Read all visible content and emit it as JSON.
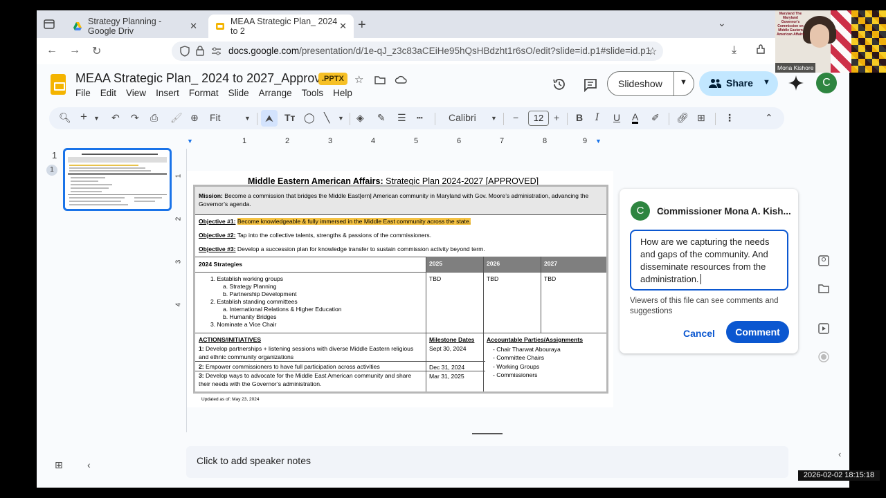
{
  "browser": {
    "tabs": [
      {
        "label": "Strategy Planning - Google Driv",
        "active": false
      },
      {
        "label": "MEAA Strategic Plan_ 2024 to 2",
        "active": true
      }
    ],
    "url_prefix": "docs.google.com",
    "url_rest": "/presentation/d/1e-qJ_z3c83aCEiHe95hQsHBdzht1r6sO/edit?slide=id.p1#slide=id.p1"
  },
  "doc": {
    "title": "MEAA Strategic Plan_ 2024 to 2027_Approved",
    "badge": ".PPTX",
    "menus": [
      "File",
      "Edit",
      "View",
      "Insert",
      "Format",
      "Slide",
      "Arrange",
      "Tools",
      "Help"
    ],
    "slideshow_label": "Slideshow",
    "share_label": "Share",
    "avatar_letter": "C"
  },
  "toolbar": {
    "zoom": "Fit",
    "font": "Calibri",
    "font_size": "12"
  },
  "filmstrip": {
    "slide_number": "1",
    "badge": "1"
  },
  "ruler": [
    "1",
    "2",
    "3",
    "4",
    "5",
    "6",
    "7",
    "8",
    "9"
  ],
  "vruler": [
    "1",
    "2",
    "3",
    "4"
  ],
  "slide": {
    "title_bold": "Middle Eastern American Affairs:",
    "title_rest": " Strategic Plan 2024-2027 [APPROVED]",
    "mission_label": "Mission:",
    "mission_text": " Become a commission that bridges the Middle East[ern] American community in Maryland with Gov. Moore’s administration, advancing the Governor’s agenda.",
    "objectives": [
      {
        "label": "Objective #1:",
        "text": "Become knowledgeable & fully immersed in the Middle East community across the state."
      },
      {
        "label": "Objective #2:",
        "text": "Tap into the collective talents, strengths & passions of the commissioners."
      },
      {
        "label": "Objective #3:",
        "text": "Develop a succession plan for knowledge transfer to sustain commission activity beyond term."
      }
    ],
    "strategies_header": "2024 Strategies",
    "year_headers": [
      "2025",
      "2026",
      "2027"
    ],
    "strategies": [
      "1.     Establish working groups",
      "a.     Strategy Planning",
      "b.     Partnership Development",
      "2.     Establish standing committees",
      "a.     International Relations & Higher Education",
      "b.     Humanity Bridges",
      "3.     Nominate a Vice Chair"
    ],
    "tbd": [
      "TBD",
      "TBD",
      "TBD"
    ],
    "actions_header": "ACTIONS/INITIATIVES",
    "milestone_header_1": "Milestone",
    "milestone_header_2": "Dates",
    "accountable_header": "Accountable Parties/Assignments",
    "actions": [
      {
        "num": "1:",
        "text": "Develop partnerships + listening sessions with diverse Middle Eastern religious and ethnic community organizations",
        "date": "Sept 30, 2024"
      },
      {
        "num": "2:",
        "text": "Empower commissioners to have full participation across activities",
        "date": "Dec 31, 2024"
      },
      {
        "num": "3:",
        "text": "Develop ways to advocate for the Middle East American community and share their needs with the Governor’s administration.",
        "date": "Mar 31, 2025"
      }
    ],
    "accountable": [
      "-     Chair Tharwat Abouraya",
      "-     Committee Chairs",
      "-     Working Groups",
      "-     Commissioners"
    ],
    "updated": "Updated as of: May 23, 2024"
  },
  "comment": {
    "avatar_letter": "C",
    "author": "Commissioner Mona A. Kish...",
    "text": "How are we capturing the needs and gaps of the community. And disseminate resources from the administration.",
    "note": "Viewers of this file can see comments and suggestions",
    "cancel_label": "Cancel",
    "submit_label": "Comment"
  },
  "notes": {
    "placeholder": "Click to add speaker notes"
  },
  "webcam": {
    "name": "Mona Kishore",
    "seal": "Maryland The Maryland Governor's Commission on Middle Eastern American Affairs"
  },
  "timestamp": "2026-02-02  18:15:18",
  "colors": {
    "accent": "#0b57d0",
    "share": "#c2e7ff",
    "highlight": "#f5c242",
    "table_header": "#7f7f7f"
  }
}
